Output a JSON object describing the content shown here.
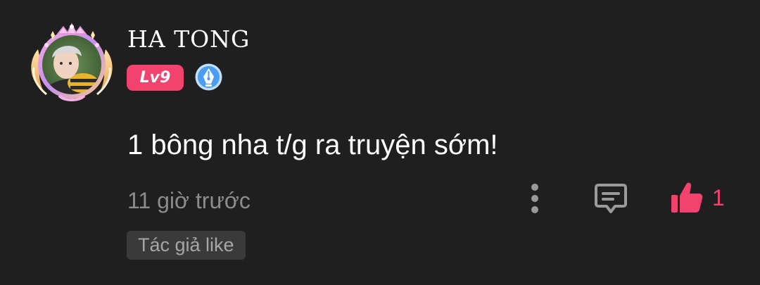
{
  "comment": {
    "username": "HA TONG",
    "level_badge": "Lv9",
    "text": "1 bông nha t/g ra truyện sớm!",
    "timestamp": "11 giờ trước",
    "like_count": "1",
    "author_liked_tag": "Tác giả like"
  },
  "icons": {
    "avatar_frame": "avatar-frame-icon",
    "pen_badge": "pen-nib-badge-icon",
    "more": "more-vertical-icon",
    "reply": "comment-reply-icon",
    "like": "thumbs-up-icon"
  },
  "colors": {
    "background": "#1f1f1f",
    "accent": "#f2436e",
    "muted_text": "#8c8c8c",
    "tag_background": "#3a3a3a",
    "badge_blue": "#4a9df0"
  }
}
